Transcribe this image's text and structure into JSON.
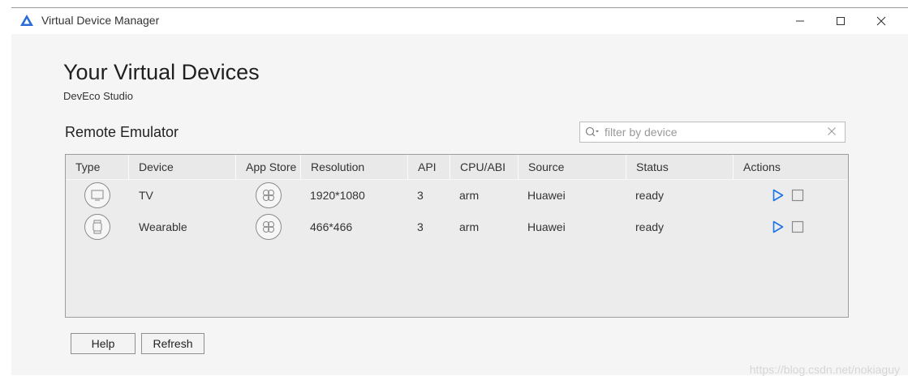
{
  "window": {
    "title": "Virtual Device Manager",
    "controls": [
      "minimize-icon",
      "maximize-icon",
      "close-icon"
    ]
  },
  "header": {
    "title": "Your Virtual Devices",
    "subtitle": "DevEco Studio"
  },
  "section": {
    "title": "Remote Emulator"
  },
  "search": {
    "placeholder": "filter by device",
    "value": ""
  },
  "table": {
    "columns": [
      "Type",
      "Device",
      "App Store",
      "Resolution",
      "API",
      "CPU/ABI",
      "Source",
      "Status",
      "Actions"
    ],
    "rows": [
      {
        "type_icon": "tv-icon",
        "device": "TV",
        "appstore_icon": "app-store-icon",
        "resolution": "1920*1080",
        "api": "3",
        "cpu": "arm",
        "source": "Huawei",
        "status": "ready"
      },
      {
        "type_icon": "watch-icon",
        "device": "Wearable",
        "appstore_icon": "app-store-icon",
        "resolution": "466*466",
        "api": "3",
        "cpu": "arm",
        "source": "Huawei",
        "status": "ready"
      }
    ],
    "action_icons": [
      "play-icon",
      "stop-icon"
    ]
  },
  "footer": {
    "help_label": "Help",
    "refresh_label": "Refresh"
  },
  "watermark": "https://blog.csdn.net/nokiaguy",
  "colors": {
    "accent": "#1a73e8",
    "logo": "#2b6cd6"
  }
}
